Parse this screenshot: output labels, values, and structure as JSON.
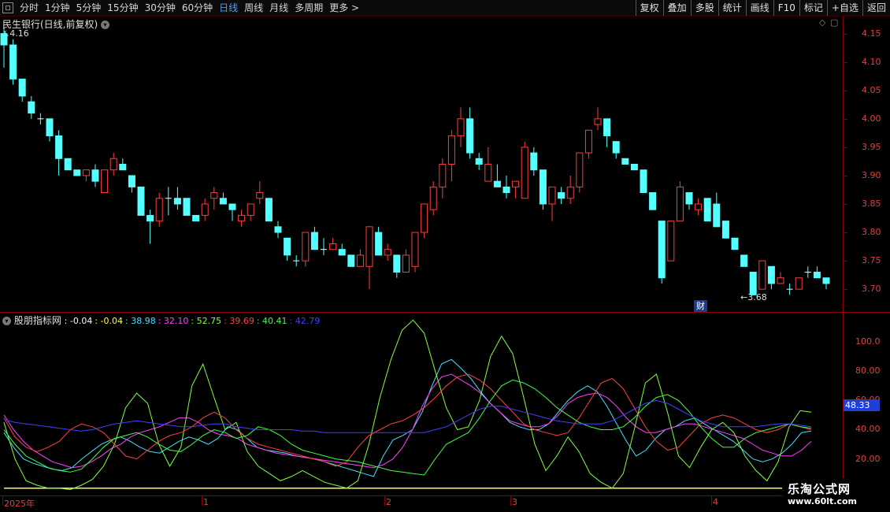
{
  "toolbar": {
    "periods": [
      "分时",
      "1分钟",
      "5分钟",
      "15分钟",
      "30分钟",
      "60分钟",
      "日线",
      "周线",
      "月线",
      "多周期",
      "更多 >"
    ],
    "active_period": "日线",
    "buttons": [
      "复权",
      "叠加",
      "多股",
      "统计",
      "画线",
      "F10",
      "标记",
      "+自选",
      "返回"
    ]
  },
  "main_pane": {
    "title": "民生银行(日线,前复权)",
    "high_marker": "4.16",
    "low_marker": "3.68",
    "finance_badge": "财",
    "price_ticks": [
      "4.15",
      "4.10",
      "4.05",
      "4.00",
      "3.95",
      "3.90",
      "3.85",
      "3.80",
      "3.75",
      "3.70"
    ]
  },
  "indicator_pane": {
    "title": "股朋指标网",
    "values": [
      {
        "text": ": -0.04",
        "color": "#ffffff"
      },
      {
        "text": ": -0.04",
        "color": "#ffff40"
      },
      {
        "text": ": 38.98",
        "color": "#40e0ff"
      },
      {
        "text": ": 32.10",
        "color": "#ff40ff"
      },
      {
        "text": ": 52.75",
        "color": "#80ff40"
      },
      {
        "text": ": 39.69",
        "color": "#ff4040"
      },
      {
        "text": ": 40.41",
        "color": "#40ff40"
      },
      {
        "text": ": 42.79",
        "color": "#4040ff"
      }
    ],
    "ticks": [
      "100.0",
      "80.00",
      "60.00",
      "40.00",
      "20.00"
    ],
    "current_value": "48.33"
  },
  "date_axis": {
    "labels": [
      "2025年",
      "1",
      "2",
      "3",
      "4"
    ]
  },
  "watermark": {
    "line1": "乐淘公式网",
    "line2": "www.60lt.com"
  },
  "chart_data": {
    "type": "candlestick",
    "ylim": [
      3.66,
      4.18
    ],
    "candles": [
      [
        4.13,
        4.16,
        4.09,
        4.15,
        "d"
      ],
      [
        4.13,
        4.14,
        4.06,
        4.07,
        "d"
      ],
      [
        4.07,
        4.07,
        4.03,
        4.04,
        "d"
      ],
      [
        4.03,
        4.04,
        4.0,
        4.01,
        "d"
      ],
      [
        4.0,
        4.01,
        3.99,
        4.0,
        "d"
      ],
      [
        4.0,
        4.0,
        3.96,
        3.97,
        "d"
      ],
      [
        3.97,
        3.98,
        3.9,
        3.93,
        "d"
      ],
      [
        3.93,
        3.93,
        3.91,
        3.91,
        "d"
      ],
      [
        3.91,
        3.91,
        3.9,
        3.9,
        "d"
      ],
      [
        3.9,
        3.91,
        3.89,
        3.91,
        "u"
      ],
      [
        3.91,
        3.92,
        3.88,
        3.89,
        "d"
      ],
      [
        3.87,
        3.91,
        3.87,
        3.91,
        "u"
      ],
      [
        3.91,
        3.94,
        3.9,
        3.93,
        "u"
      ],
      [
        3.92,
        3.93,
        3.91,
        3.91,
        "d"
      ],
      [
        3.9,
        3.9,
        3.87,
        3.88,
        "d"
      ],
      [
        3.88,
        3.88,
        3.83,
        3.83,
        "d"
      ],
      [
        3.83,
        3.84,
        3.78,
        3.82,
        "d"
      ],
      [
        3.82,
        3.87,
        3.81,
        3.86,
        "u"
      ],
      [
        3.86,
        3.88,
        3.83,
        3.86,
        "d"
      ],
      [
        3.86,
        3.88,
        3.84,
        3.85,
        "d"
      ],
      [
        3.86,
        3.86,
        3.83,
        3.83,
        "d"
      ],
      [
        3.83,
        3.83,
        3.82,
        3.82,
        "d"
      ],
      [
        3.83,
        3.86,
        3.82,
        3.85,
        "u"
      ],
      [
        3.86,
        3.88,
        3.84,
        3.87,
        "u"
      ],
      [
        3.86,
        3.87,
        3.85,
        3.85,
        "d"
      ],
      [
        3.85,
        3.85,
        3.82,
        3.84,
        "d"
      ],
      [
        3.83,
        3.84,
        3.81,
        3.82,
        "u"
      ],
      [
        3.83,
        3.85,
        3.82,
        3.85,
        "u"
      ],
      [
        3.86,
        3.89,
        3.85,
        3.87,
        "u"
      ],
      [
        3.86,
        3.86,
        3.82,
        3.82,
        "d"
      ],
      [
        3.81,
        3.82,
        3.79,
        3.8,
        "d"
      ],
      [
        3.79,
        3.79,
        3.75,
        3.76,
        "d"
      ],
      [
        3.75,
        3.76,
        3.74,
        3.75,
        "d"
      ],
      [
        3.75,
        3.8,
        3.74,
        3.8,
        "u"
      ],
      [
        3.8,
        3.81,
        3.77,
        3.77,
        "d"
      ],
      [
        3.77,
        3.79,
        3.76,
        3.77,
        "d"
      ],
      [
        3.78,
        3.79,
        3.77,
        3.77,
        "u"
      ],
      [
        3.77,
        3.78,
        3.76,
        3.76,
        "d"
      ],
      [
        3.76,
        3.76,
        3.74,
        3.74,
        "d"
      ],
      [
        3.74,
        3.77,
        3.74,
        3.76,
        "u"
      ],
      [
        3.74,
        3.81,
        3.7,
        3.81,
        "u"
      ],
      [
        3.8,
        3.81,
        3.76,
        3.76,
        "d"
      ],
      [
        3.77,
        3.78,
        3.75,
        3.76,
        "u"
      ],
      [
        3.76,
        3.76,
        3.72,
        3.73,
        "d"
      ],
      [
        3.73,
        3.77,
        3.73,
        3.76,
        "u"
      ],
      [
        3.74,
        3.8,
        3.73,
        3.8,
        "u"
      ],
      [
        3.8,
        3.85,
        3.79,
        3.85,
        "u"
      ],
      [
        3.84,
        3.89,
        3.83,
        3.88,
        "u"
      ],
      [
        3.88,
        3.93,
        3.86,
        3.92,
        "u"
      ],
      [
        3.92,
        3.98,
        3.89,
        3.97,
        "u"
      ],
      [
        3.97,
        4.02,
        3.95,
        4.0,
        "u"
      ],
      [
        4.0,
        4.02,
        3.93,
        3.94,
        "d"
      ],
      [
        3.93,
        3.94,
        3.91,
        3.92,
        "d"
      ],
      [
        3.92,
        3.95,
        3.89,
        3.89,
        "u"
      ],
      [
        3.89,
        3.92,
        3.88,
        3.88,
        "d"
      ],
      [
        3.88,
        3.9,
        3.86,
        3.87,
        "d"
      ],
      [
        3.88,
        3.89,
        3.86,
        3.89,
        "u"
      ],
      [
        3.86,
        3.96,
        3.86,
        3.95,
        "u"
      ],
      [
        3.94,
        3.95,
        3.9,
        3.91,
        "d"
      ],
      [
        3.91,
        3.91,
        3.84,
        3.85,
        "d"
      ],
      [
        3.85,
        3.88,
        3.82,
        3.88,
        "u"
      ],
      [
        3.87,
        3.88,
        3.85,
        3.86,
        "d"
      ],
      [
        3.86,
        3.9,
        3.85,
        3.88,
        "u"
      ],
      [
        3.88,
        3.94,
        3.87,
        3.94,
        "u"
      ],
      [
        3.94,
        3.98,
        3.93,
        3.98,
        "u"
      ],
      [
        3.99,
        4.02,
        3.98,
        4.0,
        "u"
      ],
      [
        4.0,
        4.0,
        3.95,
        3.97,
        "d"
      ],
      [
        3.96,
        3.96,
        3.93,
        3.94,
        "d"
      ],
      [
        3.93,
        3.93,
        3.92,
        3.92,
        "d"
      ],
      [
        3.92,
        3.92,
        3.91,
        3.91,
        "d"
      ],
      [
        3.91,
        3.91,
        3.87,
        3.87,
        "d"
      ],
      [
        3.87,
        3.87,
        3.84,
        3.84,
        "d"
      ],
      [
        3.82,
        3.82,
        3.71,
        3.72,
        "d"
      ],
      [
        3.75,
        3.82,
        3.75,
        3.82,
        "u"
      ],
      [
        3.82,
        3.89,
        3.82,
        3.88,
        "u"
      ],
      [
        3.87,
        3.87,
        3.84,
        3.85,
        "d"
      ],
      [
        3.84,
        3.86,
        3.83,
        3.85,
        "u"
      ],
      [
        3.86,
        3.86,
        3.82,
        3.82,
        "d"
      ],
      [
        3.85,
        3.87,
        3.81,
        3.81,
        "d"
      ],
      [
        3.82,
        3.82,
        3.79,
        3.79,
        "d"
      ],
      [
        3.79,
        3.79,
        3.77,
        3.77,
        "d"
      ],
      [
        3.76,
        3.76,
        3.74,
        3.74,
        "d"
      ],
      [
        3.73,
        3.73,
        3.69,
        3.69,
        "d"
      ],
      [
        3.7,
        3.75,
        3.7,
        3.75,
        "u"
      ],
      [
        3.74,
        3.74,
        3.7,
        3.71,
        "d"
      ],
      [
        3.72,
        3.73,
        3.71,
        3.71,
        "u"
      ],
      [
        3.7,
        3.71,
        3.69,
        3.7,
        "d"
      ],
      [
        3.7,
        3.72,
        3.7,
        3.72,
        "u"
      ],
      [
        3.73,
        3.74,
        3.72,
        3.73,
        "d"
      ],
      [
        3.73,
        3.74,
        3.72,
        3.72,
        "d"
      ],
      [
        3.72,
        3.72,
        3.7,
        3.71,
        "d"
      ]
    ],
    "indicator_ylim": [
      -5,
      120
    ],
    "indicator_series": [
      {
        "color": "#ffff40",
        "values": [
          -0.04
        ]
      },
      {
        "color": "#40e0ff",
        "values": [
          38,
          28,
          20,
          17,
          15,
          13,
          12,
          14,
          20,
          25,
          30,
          33,
          35,
          32,
          28,
          25,
          24,
          28,
          32,
          35,
          33,
          30,
          34,
          42,
          40,
          34,
          28,
          26,
          25,
          24,
          22,
          21,
          20,
          18,
          16,
          14,
          12,
          10,
          8,
          22,
          33,
          36,
          40,
          52,
          70,
          85,
          88,
          82,
          75,
          66,
          58,
          52,
          45,
          42,
          40,
          40,
          44,
          52,
          60,
          66,
          70,
          66,
          56,
          44,
          32,
          22,
          26,
          34,
          40,
          42,
          46,
          48,
          44,
          40,
          36,
          32,
          26,
          20,
          18,
          20,
          24,
          30,
          38,
          39
        ]
      },
      {
        "color": "#ff40ff",
        "values": [
          50,
          40,
          32,
          26,
          22,
          18,
          16,
          14,
          15,
          18,
          22,
          27,
          30,
          35,
          38,
          40,
          42,
          45,
          48,
          48,
          45,
          40,
          37,
          36,
          34,
          30,
          28,
          26,
          24,
          23,
          22,
          21,
          20,
          19,
          18,
          17,
          16,
          15,
          14,
          16,
          20,
          28,
          40,
          56,
          68,
          76,
          78,
          74,
          70,
          65,
          58,
          52,
          46,
          44,
          42,
          42,
          44,
          50,
          58,
          62,
          64,
          65,
          62,
          56,
          48,
          42,
          38,
          38,
          40,
          42,
          44,
          44,
          42,
          40,
          38,
          36,
          34,
          30,
          26,
          24,
          22,
          22,
          26,
          32
        ]
      },
      {
        "color": "#80ff40",
        "values": [
          45,
          20,
          5,
          2,
          0,
          0,
          -1,
          2,
          6,
          15,
          30,
          55,
          65,
          58,
          30,
          15,
          28,
          70,
          85,
          62,
          40,
          45,
          25,
          15,
          10,
          5,
          8,
          12,
          8,
          4,
          2,
          0,
          5,
          30,
          62,
          88,
          108,
          115,
          106,
          80,
          55,
          40,
          42,
          60,
          90,
          104,
          92,
          62,
          30,
          12,
          22,
          35,
          25,
          10,
          4,
          0,
          10,
          40,
          72,
          78,
          52,
          22,
          14,
          28,
          40,
          45,
          38,
          22,
          12,
          5,
          18,
          42,
          53,
          52
        ]
      },
      {
        "color": "#ff4040",
        "values": [
          48,
          35,
          28,
          25,
          28,
          32,
          40,
          44,
          42,
          38,
          30,
          22,
          20,
          26,
          32,
          36,
          38,
          42,
          48,
          52,
          48,
          40,
          34,
          30,
          28,
          26,
          24,
          22,
          20,
          18,
          15,
          18,
          28,
          36,
          40,
          44,
          46,
          50,
          55,
          62,
          70,
          76,
          78,
          74,
          68,
          60,
          52,
          44,
          40,
          38,
          36,
          38,
          48,
          60,
          72,
          75,
          68,
          55,
          42,
          32,
          26,
          28,
          36,
          44,
          48,
          50,
          48,
          44,
          40,
          38,
          40,
          44,
          42,
          40
        ]
      },
      {
        "color": "#40ff40",
        "values": [
          40,
          30,
          22,
          18,
          14,
          12,
          11,
          13,
          20,
          28,
          34,
          36,
          38,
          35,
          30,
          26,
          25,
          30,
          36,
          40,
          38,
          34,
          36,
          42,
          40,
          36,
          30,
          26,
          24,
          22,
          20,
          19,
          18,
          16,
          14,
          12,
          11,
          10,
          9,
          20,
          30,
          34,
          38,
          48,
          60,
          70,
          74,
          72,
          68,
          62,
          55,
          50,
          45,
          42,
          40,
          40,
          42,
          48,
          56,
          62,
          64,
          60,
          52,
          42,
          34,
          28,
          28,
          34,
          38,
          40,
          42,
          44,
          42,
          41
        ]
      },
      {
        "color": "#4040ff",
        "values": [
          47,
          45,
          44,
          43,
          42,
          41,
          40,
          39,
          40,
          42,
          44,
          45,
          46,
          45,
          44,
          43,
          42,
          42,
          43,
          44,
          44,
          42,
          41,
          40,
          40,
          40,
          40,
          39,
          39,
          38,
          38,
          38,
          38,
          38,
          38,
          38,
          38,
          38,
          38,
          40,
          42,
          46,
          50,
          54,
          56,
          56,
          54,
          52,
          50,
          48,
          46,
          45,
          44,
          44,
          44,
          46,
          50,
          54,
          58,
          60,
          58,
          54,
          50,
          46,
          44,
          42,
          42,
          42,
          42,
          43,
          44,
          44,
          43,
          42
        ]
      }
    ]
  }
}
